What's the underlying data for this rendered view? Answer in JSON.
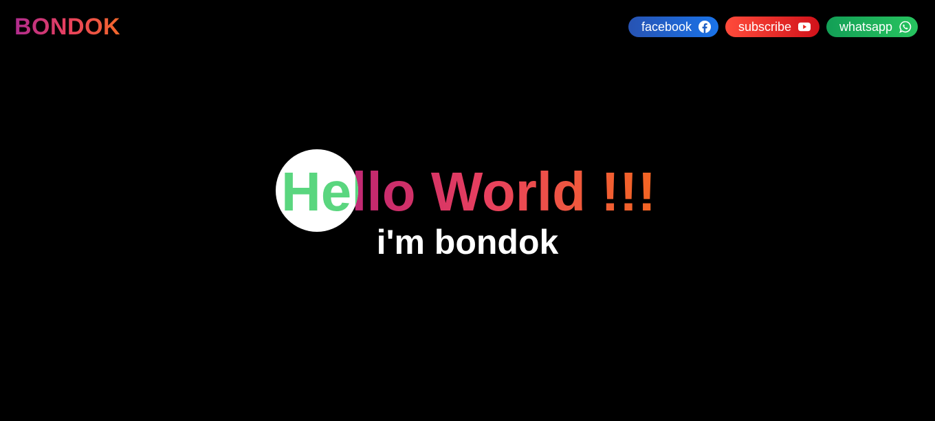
{
  "header": {
    "logo": "BONDOK"
  },
  "nav": {
    "items": [
      {
        "label": "facebook",
        "icon": "facebook-icon",
        "color": "#1f5fc4"
      },
      {
        "label": "subscribe",
        "icon": "youtube-icon",
        "color": "#e8261f"
      },
      {
        "label": "whatsapp",
        "icon": "whatsapp-icon",
        "color": "#1cb35a"
      }
    ]
  },
  "hero": {
    "headline": "Hello World !!!",
    "subtitle": "i'm bondok"
  },
  "colors": {
    "background": "#000000",
    "spotlight": "#ffffff",
    "spotlight_text": "#5ad67f",
    "gradient_start": "#a8258e",
    "gradient_end": "#f26522"
  }
}
